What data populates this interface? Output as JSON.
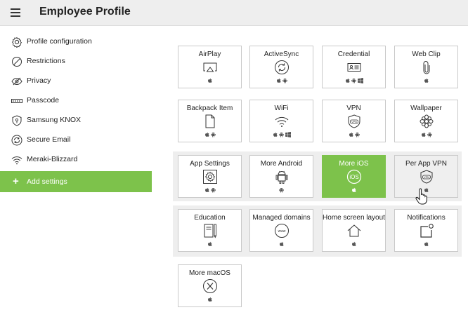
{
  "header": {
    "title": "Employee Profile",
    "menu_icon": "hamburger-icon"
  },
  "sidebar": {
    "items": [
      {
        "label": "Profile configuration",
        "icon": "gear-icon"
      },
      {
        "label": "Restrictions",
        "icon": "prohibited-icon"
      },
      {
        "label": "Privacy",
        "icon": "eye-icon"
      },
      {
        "label": "Passcode",
        "icon": "passcode-icon"
      },
      {
        "label": "Samsung KNOX",
        "icon": "knox-icon"
      },
      {
        "label": "Secure Email",
        "icon": "sync-icon"
      },
      {
        "label": "Meraki-Blizzard",
        "icon": "wifi-icon"
      }
    ],
    "add_label": "Add settings"
  },
  "tiles": [
    {
      "label": "AirPlay",
      "icon": "airplay-icon",
      "platforms": [
        "apple"
      ]
    },
    {
      "label": "ActiveSync",
      "icon": "sync-icon",
      "platforms": [
        "apple",
        "android"
      ]
    },
    {
      "label": "Credential",
      "icon": "id-card-icon",
      "platforms": [
        "apple",
        "android",
        "windows"
      ]
    },
    {
      "label": "Web Clip",
      "icon": "paperclip-icon",
      "platforms": [
        "apple"
      ]
    },
    {
      "label": "Backpack Item",
      "icon": "file-icon",
      "platforms": [
        "apple",
        "android"
      ]
    },
    {
      "label": "WiFi",
      "icon": "wifi-icon",
      "platforms": [
        "apple",
        "android",
        "windows"
      ]
    },
    {
      "label": "VPN",
      "icon": "vpn-shield-icon",
      "platforms": [
        "apple",
        "android"
      ]
    },
    {
      "label": "Wallpaper",
      "icon": "flower-icon",
      "platforms": [
        "apple",
        "android"
      ]
    },
    {
      "label": "App Settings",
      "icon": "gear-box-icon",
      "platforms": [
        "apple",
        "android"
      ]
    },
    {
      "label": "More Android",
      "icon": "android-icon",
      "platforms": [
        "android"
      ]
    },
    {
      "label": "More iOS",
      "icon": "ios-icon",
      "platforms": [
        "apple"
      ],
      "state": "active"
    },
    {
      "label": "Per App VPN",
      "icon": "vpn-shield-icon",
      "platforms": [
        "apple"
      ],
      "state": "hover"
    },
    {
      "label": "Education",
      "icon": "notebook-icon",
      "platforms": [
        "apple"
      ]
    },
    {
      "label": "Managed domains",
      "icon": "www-icon",
      "platforms": [
        "apple"
      ]
    },
    {
      "label": "Home screen layout",
      "icon": "home-icon",
      "platforms": [
        "apple"
      ]
    },
    {
      "label": "Notifications",
      "icon": "notification-icon",
      "platforms": [
        "apple"
      ]
    },
    {
      "label": "More macOS",
      "icon": "macos-x-icon",
      "platforms": [
        "apple"
      ]
    }
  ],
  "platform_icons": {
    "apple": "apple-icon",
    "android": "android-icon",
    "windows": "windows-icon"
  },
  "colors": {
    "accent": "#7dc24b",
    "header_bg": "#eeeeee",
    "row_highlight": "#eeeeee",
    "tile_border": "#c9c9c9"
  }
}
